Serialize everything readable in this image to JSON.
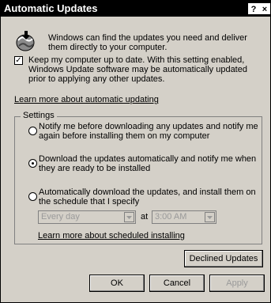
{
  "window": {
    "title": "Automatic Updates",
    "help_glyph": "?",
    "close_glyph": "×"
  },
  "intro": {
    "icon": "windows-update-globe-icon",
    "text": "Windows can find the updates you need and deliver them directly to your computer."
  },
  "keep_up_to_date": {
    "checked": true,
    "mark": "✓",
    "label": "Keep my computer up to date. With this setting enabled, Windows Update software may be automatically updated prior to applying any other updates."
  },
  "learn_more_auto_link": "Learn more about automatic updating",
  "settings": {
    "legend": "Settings",
    "options": [
      {
        "label": "Notify me before downloading any updates and notify me again before installing them on my computer",
        "selected": false
      },
      {
        "label": "Download the updates automatically and notify me when they are ready to be installed",
        "selected": true
      },
      {
        "label": "Automatically download the updates, and install them on the schedule that I specify",
        "selected": false
      }
    ],
    "schedule": {
      "day_value": "Every day",
      "at_label": "at",
      "time_value": "3:00 AM"
    },
    "learn_more_schedule_link": "Learn more about scheduled installing"
  },
  "buttons": {
    "declined": "Declined Updates",
    "ok": "OK",
    "cancel": "Cancel",
    "apply": "Apply"
  }
}
